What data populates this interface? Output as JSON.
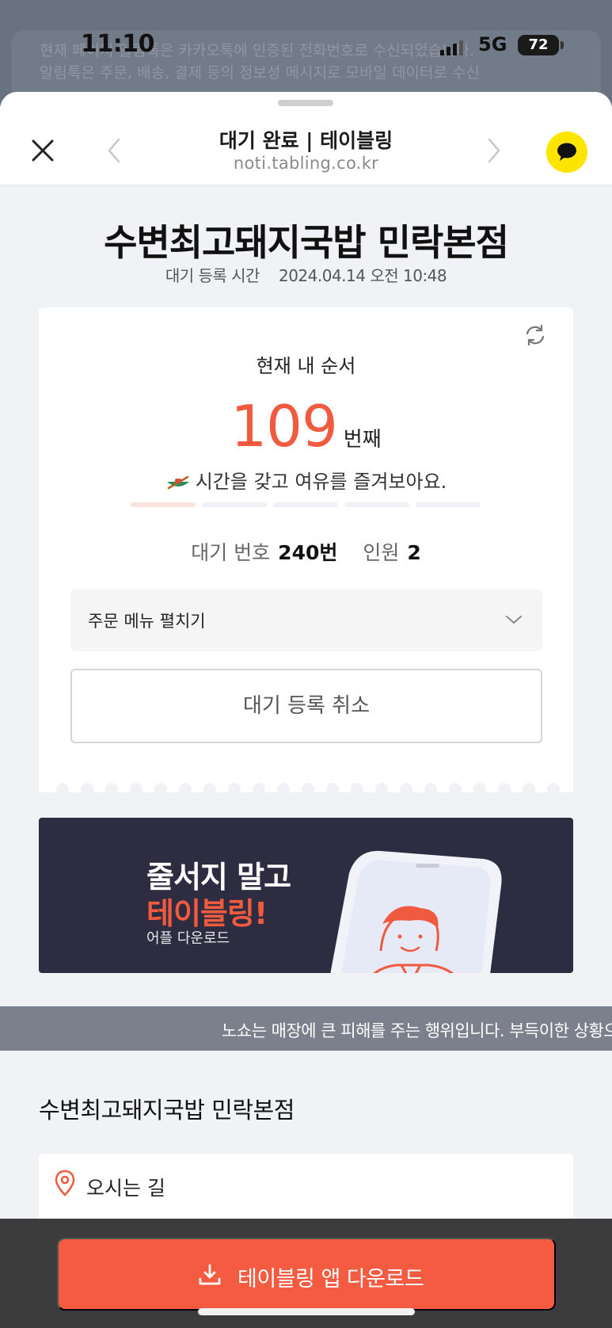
{
  "status_bar": {
    "time": "11:10",
    "network": "5G",
    "battery": "72"
  },
  "background_notification": {
    "line1": "현재 페이지 알림톡은 카카오톡에 인증된 전화번호로 수신되었습니다.",
    "line2": "알림톡은 주문, 배송, 결제 등의 정보성 메시지로 모바일 데이터로 수신"
  },
  "header": {
    "title": "대기 완료 | 테이블링",
    "url": "noti.tabling.co.kr",
    "close_icon": "close-icon",
    "prev_icon": "chevron-left-icon",
    "next_icon": "chevron-right-icon",
    "kakao_icon": "kakaotalk-bubble-icon"
  },
  "store": {
    "name": "수변최고돼지국밥 민락본점",
    "reg_label": "대기 등록 시간",
    "reg_time": "2024.04.14 오전 10:48"
  },
  "queue": {
    "label": "현재 내 순서",
    "position": "109",
    "unit": "번째",
    "tip": "시간을 갖고 여유를 즐겨보아요.",
    "progress_steps": 5,
    "progress_active": 1,
    "waiting_no_label": "대기 번호",
    "waiting_no": "240번",
    "party_label": "인원",
    "party": "2",
    "menu_toggle": "주문 메뉴 펼치기",
    "cancel_button": "대기 등록 취소"
  },
  "banner": {
    "line1": "줄서지 말고",
    "line2": "테이블링!",
    "line3": "어플 다운로드"
  },
  "notice": "노쇼는 매장에 큰 피해를 주는 행위입니다. 부득이한 상황으",
  "location": {
    "section_title": "수변최고돼지국밥 민락본점",
    "directions_label": "오시는 길"
  },
  "bottom": {
    "download_button": "테이블링 앱 다운로드"
  },
  "colors": {
    "accent": "#f55b40",
    "kakao": "#fee500",
    "banner_bg": "#2e2c40"
  }
}
